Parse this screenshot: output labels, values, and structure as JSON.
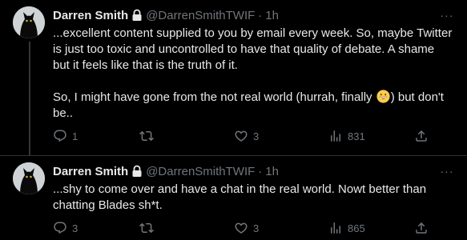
{
  "colors": {
    "background": "#000000",
    "text_primary": "#e7e9ea",
    "text_secondary": "#71767b",
    "divider": "#2f3336"
  },
  "tweets": [
    {
      "display_name": "Darren Smith",
      "handle": "@DarrenSmithTWIF",
      "separator": "·",
      "time": "1h",
      "protected_icon": "lock-icon",
      "paragraphs": [
        "...excellent content supplied to you by email every week. So, maybe Twitter is just too toxic and uncontrolled to have that quality of debate. A shame but it feels like that is the truth of it.",
        {
          "before_emoji": "So, I might have gone from the not real world (hurrah, finally ",
          "emoji": "grinning-face-emoji",
          "after_emoji": ") but don't be.."
        }
      ],
      "actions": {
        "replies": "1",
        "retweets": "",
        "likes": "3",
        "views": "831"
      }
    },
    {
      "display_name": "Darren Smith",
      "handle": "@DarrenSmithTWIF",
      "separator": "·",
      "time": "1h",
      "protected_icon": "lock-icon",
      "paragraphs": [
        "...shy to come over and have a chat in the real world. Nowt better than chatting Blades sh*t."
      ],
      "actions": {
        "replies": "3",
        "retweets": "",
        "likes": "3",
        "views": "865"
      }
    }
  ],
  "more_icon": "···"
}
